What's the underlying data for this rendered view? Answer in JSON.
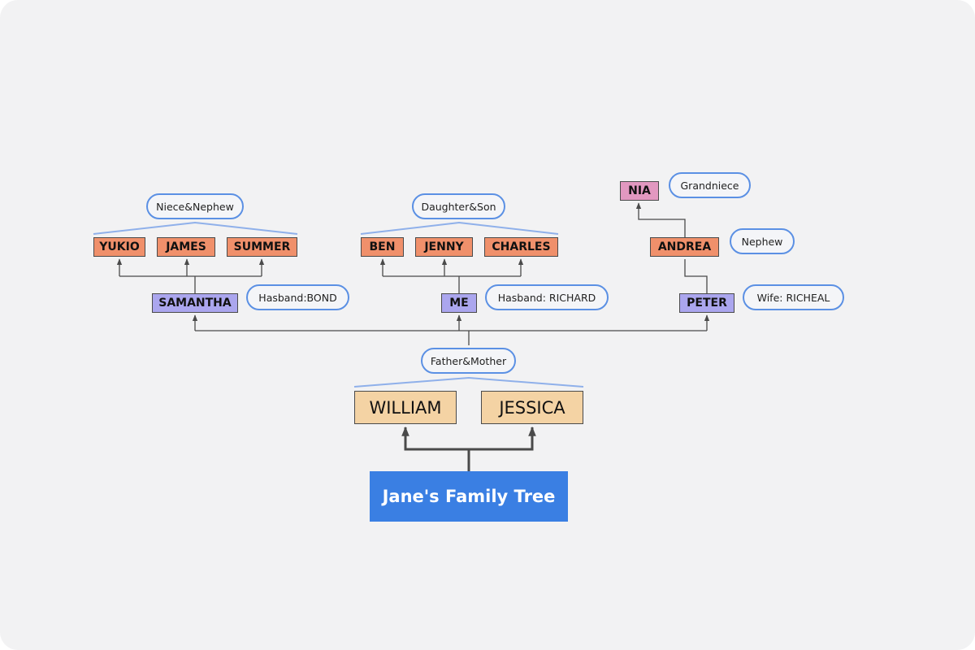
{
  "title": "Jane's Family Tree",
  "parents": {
    "label": "Father&Mother",
    "father": "WILLIAM",
    "mother": "JESSICA"
  },
  "siblings": [
    {
      "name": "SAMANTHA",
      "spouse": "Hasband:BOND",
      "children_label": "Niece&Nephew",
      "children": [
        "YUKIO",
        "JAMES",
        "SUMMER"
      ]
    },
    {
      "name": "ME",
      "spouse": "Hasband: RICHARD",
      "children_label": "Daughter&Son",
      "children": [
        "BEN",
        "JENNY",
        "CHARLES"
      ]
    },
    {
      "name": "PETER",
      "spouse": "Wife: RICHEAL",
      "child": {
        "name": "ANDREA",
        "relation": "Nephew",
        "child": {
          "name": "NIA",
          "relation": "Grandniece"
        }
      }
    }
  ],
  "colors": {
    "background": "#f2f2f3",
    "root": "#3a7fe3",
    "parents": "#f4d3a4",
    "siblings": "#aba6ee",
    "children": "#f0906b",
    "grandchild": "#e298c0",
    "callout_border": "#5b90e4"
  }
}
